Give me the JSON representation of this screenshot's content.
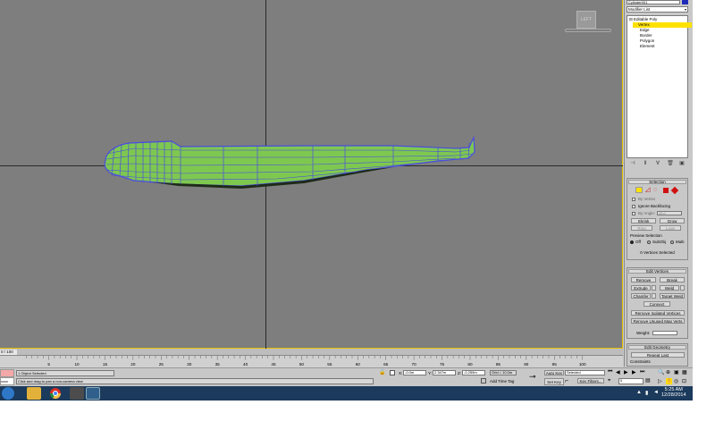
{
  "panel": {
    "object_name": "Cylinder001",
    "modifier_list": "Modifier List",
    "stack": [
      "Editable Poly",
      "Vertex",
      "Edge",
      "Border",
      "Polygon",
      "Element"
    ],
    "stack_icons": [
      "pin-icon",
      "show-end-result-icon",
      "make-unique-icon",
      "remove-modifier-icon",
      "configure-sets-icon"
    ]
  },
  "selection": {
    "title": "Selection",
    "by_vertex": "By Vertex",
    "ignore_backfacing": "Ignore Backfacing",
    "by_angle": "By Angle:",
    "by_angle_value": "45.0",
    "shrink": "Shrink",
    "grow": "Grow",
    "ring": "Ring",
    "loop": "Loop",
    "preview_title": "Preview Selection",
    "preview_options": [
      "Off",
      "SubObj",
      "Multi"
    ],
    "status": "0 Vertices Selected"
  },
  "edit_vertices": {
    "title": "Edit Vertices",
    "remove": "Remove",
    "break": "Break",
    "extrude": "Extrude",
    "weld": "Weld",
    "chamfer": "Chamfer",
    "target_weld": "Target Weld",
    "connect": "Connect",
    "remove_isolated": "Remove Isolated Vertices",
    "remove_unused": "Remove Unused Map Verts",
    "weight_label": "Weight:",
    "weight_value": ""
  },
  "edit_geometry": {
    "title": "Edit Geometry",
    "repeat_last": "Repeat Last",
    "constraints": "Constraints"
  },
  "viewport": {
    "viewcube_label": "LEFT"
  },
  "timeline": {
    "frame_counter": "0 / 100",
    "ticks": [
      5,
      10,
      15,
      20,
      25,
      30,
      35,
      40,
      45,
      50,
      55,
      60,
      65,
      70,
      75,
      80,
      85,
      90,
      95,
      100
    ]
  },
  "status": {
    "objects_selected": "1 Object Selected",
    "prompt": "Click and drag to pan a non-camera view",
    "script_label": "xxxx",
    "x_label": "X:",
    "x_value": "-0.0m",
    "y_label": "Y:",
    "y_value": "2.347m",
    "z_label": "Z:",
    "z_value": "-0.259m",
    "grid": "Grid = 10.0m",
    "add_time_tag": "Add Time Tag",
    "auto_key": "Auto Key",
    "selected": "Selected",
    "set_key": "Set Key",
    "key_filters": "Key Filters...",
    "frame_value": "0"
  },
  "taskbar": {
    "time": "5:25 AM",
    "date": "12/28/2014"
  },
  "colors": {
    "viewport_bg": "#7e7e7e",
    "mesh_fill": "#7ec850",
    "wire": "#4b4be0",
    "selection_yellow": "#ffe100"
  }
}
